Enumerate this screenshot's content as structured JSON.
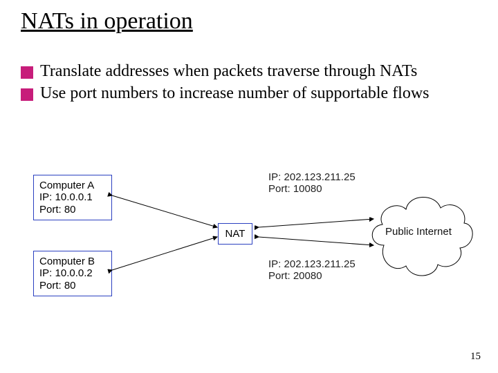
{
  "title": "NATs in operation",
  "bullets": [
    "Translate addresses when packets traverse through NATs",
    "Use port numbers to increase number of supportable flows"
  ],
  "diagram": {
    "computer_a": {
      "name": "Computer A",
      "ip": "IP: 10.0.0.1",
      "port": "Port: 80"
    },
    "computer_b": {
      "name": "Computer B",
      "ip": "IP: 10.0.0.2",
      "port": "Port: 80"
    },
    "nat_label": "NAT",
    "right_top": {
      "ip": "IP: 202.123.211.25",
      "port": "Port: 10080"
    },
    "right_bot": {
      "ip": "IP: 202.123.211.25",
      "port": "Port: 20080"
    },
    "cloud": "Public Internet"
  },
  "page_number": "15"
}
